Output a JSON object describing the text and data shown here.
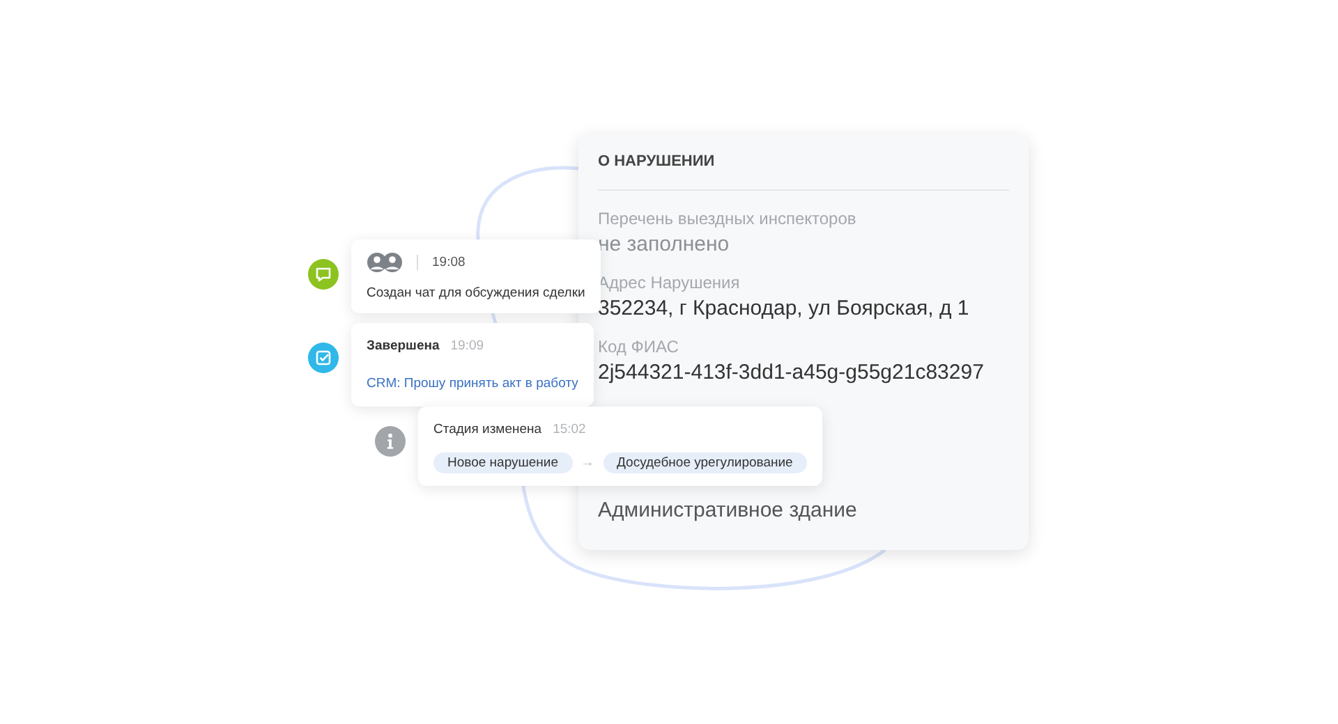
{
  "panel": {
    "title": "О НАРУШЕНИИ",
    "fields": [
      {
        "label": "Перечень выездных инспекторов",
        "value": "не заполнено",
        "empty": true
      },
      {
        "label": "Адрес Нарушения",
        "value": "352234, г Краснодар, ул Боярская, д 1",
        "empty": false
      },
      {
        "label": "Код ФИАС",
        "value": "2j544321-413f-3dd1-a45g-g55g21c83297",
        "empty": false
      }
    ],
    "footer": "Административное здание"
  },
  "events": [
    {
      "kind": "chat",
      "color": "#8cc320",
      "time": "19:08",
      "text": "Создан чат для обсуждения сделки"
    },
    {
      "kind": "task",
      "color": "#2fb8e8",
      "title": "Завершена",
      "time": "19:09",
      "text": "CRM: Прошу принять акт в работу"
    },
    {
      "kind": "stage",
      "color": "#a2a5a9",
      "title": "Стадия изменена",
      "time": "15:02",
      "from": "Новое нарушение",
      "arrow": "→",
      "to": "Досудебное урегулирование"
    }
  ]
}
